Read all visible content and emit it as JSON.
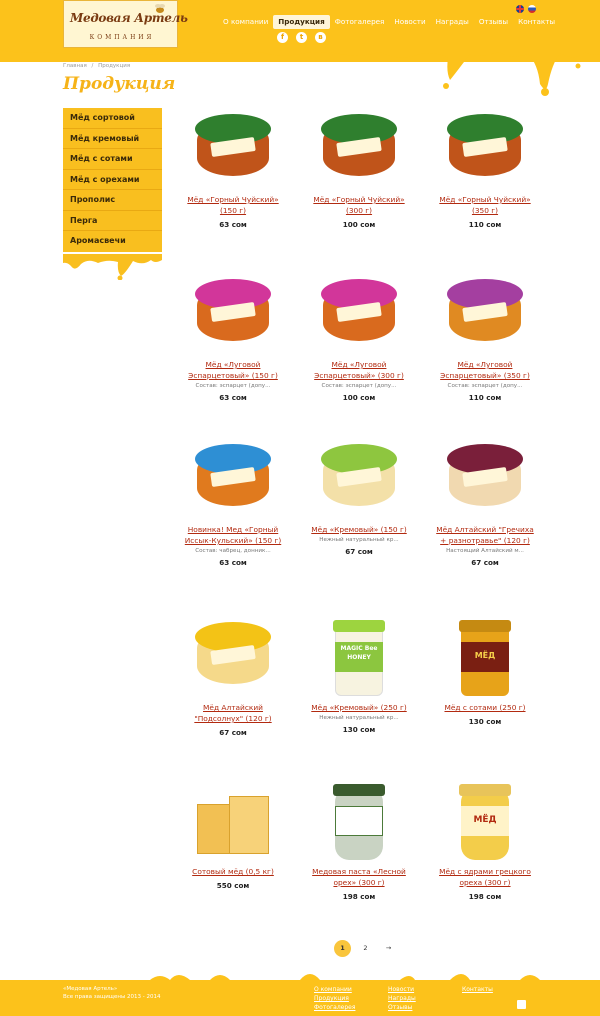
{
  "header": {
    "logo_title": "Медовая Артель",
    "logo_subtitle": "КОМПАНИЯ",
    "nav": [
      {
        "label": "О компании",
        "active": false
      },
      {
        "label": "Продукция",
        "active": true
      },
      {
        "label": "Фотогалерея",
        "active": false
      },
      {
        "label": "Новости",
        "active": false
      },
      {
        "label": "Награды",
        "active": false
      },
      {
        "label": "Отзывы",
        "active": false
      },
      {
        "label": "Контакты",
        "active": false
      }
    ],
    "social_icons": [
      "facebook-icon",
      "twitter-icon",
      "vk-icon"
    ],
    "languages": [
      "en",
      "ru"
    ]
  },
  "breadcrumb": {
    "home": "Главная",
    "separator": "/",
    "current": "Продукция"
  },
  "page_title": "Продукция",
  "sidebar": {
    "items": [
      {
        "label": "Мёд сортовой"
      },
      {
        "label": "Мёд кремовый"
      },
      {
        "label": "Мёд с сотами"
      },
      {
        "label": "Мёд с орехами"
      },
      {
        "label": "Прополис"
      },
      {
        "label": "Перга"
      },
      {
        "label": "Аромасвечи"
      }
    ]
  },
  "products": [
    {
      "name": "Мёд «Горный Чуйский» (150 г)",
      "desc": "",
      "price": "63 сом",
      "lid": "#2f7f2e",
      "body": "#c0541a"
    },
    {
      "name": "Мёд «Горный Чуйский» (300 г)",
      "desc": "",
      "price": "100 сом",
      "lid": "#2f7f2e",
      "body": "#c0541a"
    },
    {
      "name": "Мёд «Горный Чуйский» (350 г)",
      "desc": "",
      "price": "110 сом",
      "lid": "#2f7f2e",
      "body": "#c0541a"
    },
    {
      "name": "Мёд «Луговой Эспарцетовый» (150 г)",
      "desc": "Состав: эспарцет (допу...",
      "price": "63 сом",
      "lid": "#d2369a",
      "body": "#d96a1e"
    },
    {
      "name": "Мёд «Луговой Эспарцетовый» (300 г)",
      "desc": "Состав: эспарцет (допу...",
      "price": "100 сом",
      "lid": "#d2369a",
      "body": "#d96a1e"
    },
    {
      "name": "Мёд «Луговой Эспарцетовый» (350 г)",
      "desc": "Состав: эспарцет (допу...",
      "price": "110 сом",
      "lid": "#a43fa0",
      "body": "#e08a22"
    },
    {
      "name": "Новинка! Мед «Горный Иссык-Кульский» (150 г)",
      "desc": "Состав: чабрец, донник...",
      "price": "63 сом",
      "lid": "#2e8fd4",
      "body": "#e07a1e"
    },
    {
      "name": "Мёд «Кремовый» (150 г)",
      "desc": "Нежный натуральный кр...",
      "price": "67 сом",
      "lid": "#8ec63f",
      "body": "#f3e0a8"
    },
    {
      "name": "Мёд Алтайский \"Гречиха + разнотравье\" (120 г)",
      "desc": "Настоящий Алтайский м...",
      "price": "67 сом",
      "lid": "#7a1f3a",
      "body": "#f1d9b0"
    },
    {
      "name": "Мёд Алтайский \"Подсолнух\" (120 г)",
      "desc": "",
      "price": "67 сом",
      "lid": "#f3c316",
      "body": "#f5d98a"
    },
    {
      "name": "Мёд «Кремовый» (250 г)",
      "desc": "Нежный натуральный кр...",
      "price": "130 сом",
      "lid": "#9dd43f",
      "body": "#f7f3e0",
      "label_text": "MAGIC Bee HONEY"
    },
    {
      "name": "Мёд с сотами (250 г)",
      "desc": "",
      "price": "130 сом",
      "lid": "#e2a01b",
      "body": "#e7a319",
      "label_text": "МЁД"
    },
    {
      "name": "Сотовый мёд (0,5 кг)",
      "desc": "",
      "price": "550 сом",
      "lid": "#f2c053",
      "body": "#f7d279"
    },
    {
      "name": "Медовая паста «Лесной орех» (300 г)",
      "desc": "",
      "price": "198 сом",
      "lid": "#3a5b2e",
      "body": "#c9d3c3"
    },
    {
      "name": "Мёд с ядрами грецкого ореха (300 г)",
      "desc": "",
      "price": "198 сом",
      "lid": "#e8c45a",
      "body": "#f3cd4a",
      "label_text": "МЁД"
    }
  ],
  "pagination": {
    "pages": [
      "1",
      "2"
    ],
    "current": "1",
    "next": "→"
  },
  "footer": {
    "copyright_line1": "«Медовая Артель»",
    "copyright_line2": "Все права защищены 2013 - 2014",
    "col1": [
      "О компании",
      "Продукция",
      "Фотогалерея"
    ],
    "col2": [
      "Новости",
      "Награды",
      "Отзывы"
    ],
    "col3": [
      "Контакты"
    ]
  },
  "colors": {
    "accent": "#fcc21b",
    "link": "#b22a10",
    "title": "#f6b318"
  }
}
